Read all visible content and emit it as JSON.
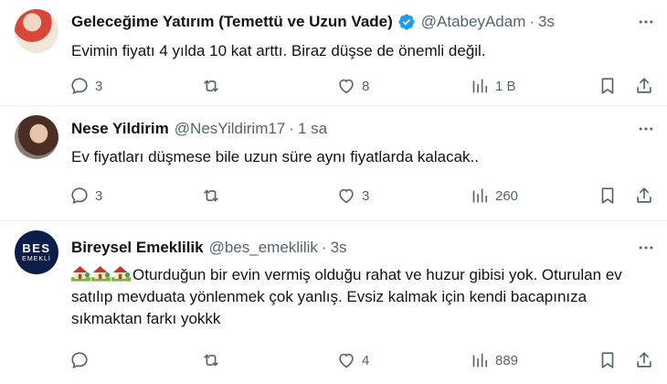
{
  "colors": {
    "text": "#0f1419",
    "muted": "#536471",
    "verified": "#1d9bf0",
    "divider": "#eff3f4"
  },
  "tweets": [
    {
      "name": "Geleceğime Yatırım (Temettü ve Uzun Vade)",
      "verified": true,
      "handle": "@AtabeyAdam",
      "dot": "·",
      "time": "3s",
      "text": "Evimin fiyatı 4 yılda 10 kat arttı. Biraz düşse de önemli değil.",
      "replies": "3",
      "retweets": "",
      "likes": "8",
      "views": "1 B"
    },
    {
      "name": "Nese Yildirim",
      "verified": false,
      "handle": "@NesYildirim17",
      "dot": "·",
      "time": "1 sa",
      "text": "Ev fiyatları düşmese bile uzun süre aynı fiyatlarda kalacak..",
      "replies": "3",
      "retweets": "",
      "likes": "3",
      "views": "260"
    },
    {
      "name": "Bireysel Emeklilik",
      "verified": false,
      "handle": "@bes_emeklilik",
      "dot": "·",
      "time": "3s",
      "avatar_text": [
        "BES",
        "EMEKLİ"
      ],
      "emoji_icon": "house-with-garden-emoji",
      "text": "Oturduğun bir evin vermiş olduğu rahat ve huzur gibisi yok. Oturulan ev satılıp mevduata yönlenmek çok yanlış. Evsiz kalmak için kendi bacapınıza sıkmaktan farkı yokkk",
      "replies": "",
      "retweets": "",
      "likes": "4",
      "views": "889"
    }
  ]
}
